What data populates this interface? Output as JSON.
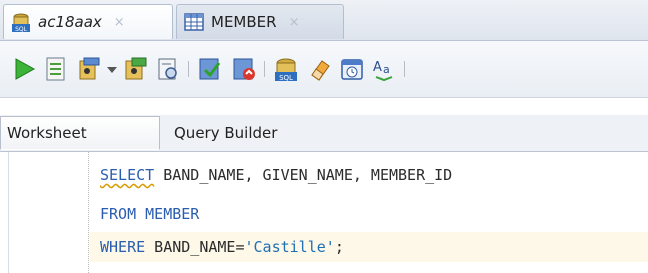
{
  "tabs": [
    {
      "label": "ac18aax",
      "close": "×",
      "icon": "sql-worksheet-icon",
      "active": true
    },
    {
      "label": "MEMBER",
      "close": "×",
      "icon": "table-grid-icon",
      "active": false
    }
  ],
  "toolbar": {
    "buttons": [
      "run-statement-icon",
      "run-script-icon",
      "explain-plan-icon",
      "autotrace-icon",
      "sql-tuning-icon",
      "commit-icon",
      "rollback-icon",
      "unshared-sql-icon",
      "clear-eraser-icon",
      "sql-history-icon",
      "to-upper-lower-icon"
    ]
  },
  "subtabs": {
    "worksheet": "Worksheet",
    "query_builder": "Query Builder"
  },
  "editor": {
    "line1": {
      "kw": "SELECT",
      "rest": " BAND_NAME, GIVEN_NAME, MEMBER_ID"
    },
    "line2": {
      "kw1": "FROM",
      "rest": " ",
      "kw2": "MEMBER"
    },
    "line3": {
      "kw": "WHERE",
      "rest": " BAND_NAME=",
      "str": "'Castille'",
      "end": ";"
    }
  },
  "colors": {
    "keyword": "#2a5db0",
    "current_line": "#fdf8e8",
    "accent": "#b3bfd0"
  }
}
